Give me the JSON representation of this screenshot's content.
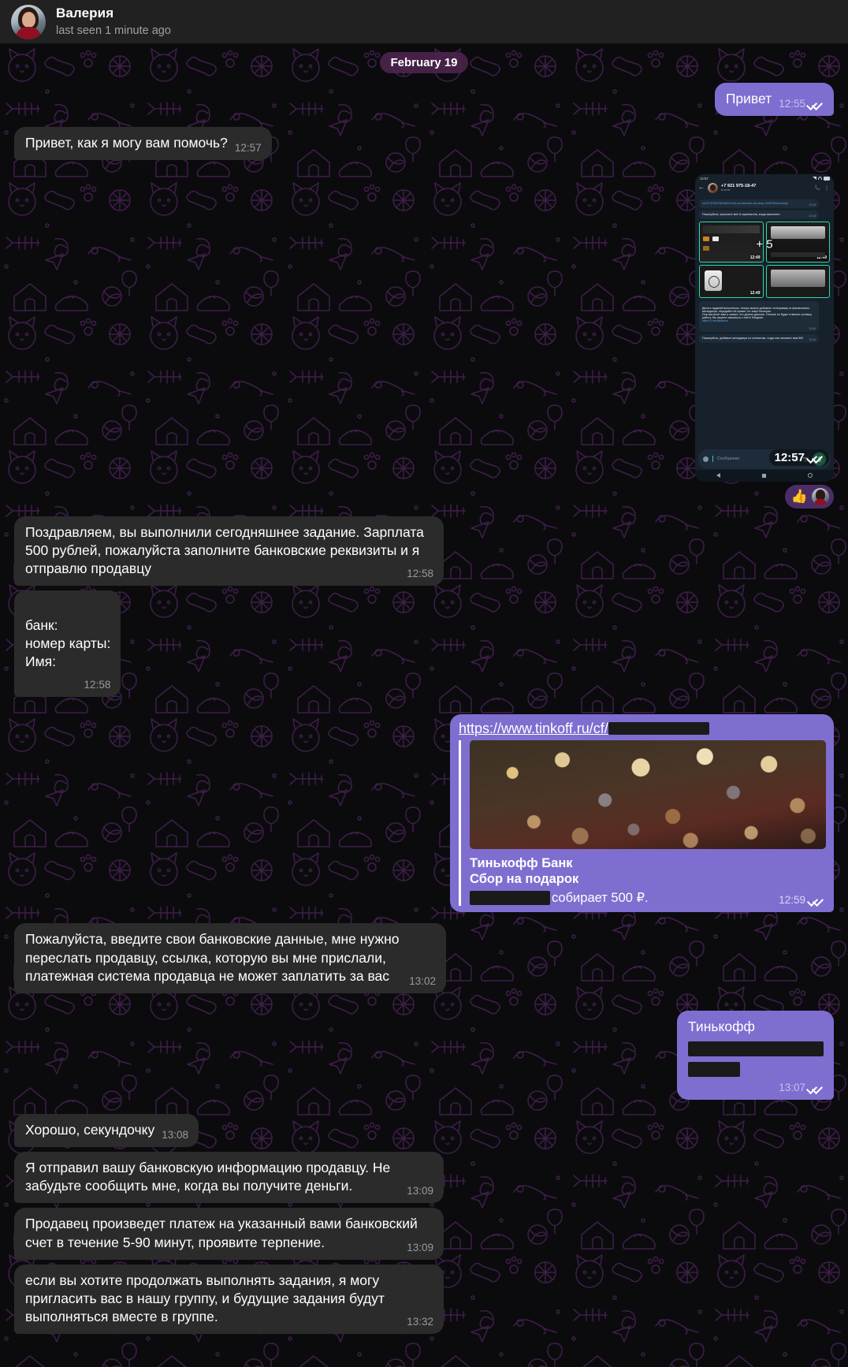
{
  "header": {
    "name": "Валерия",
    "status": "last seen 1 minute ago",
    "avatar_icon": "user-avatar"
  },
  "date_divider": "February 19",
  "messages": [
    {
      "id": "m1",
      "dir": "out",
      "text": "Привет",
      "time": "12:55",
      "read": true
    },
    {
      "id": "m2",
      "dir": "in",
      "text": "Привет, как я могу вам помочь?",
      "time": "12:57"
    },
    {
      "id": "m3",
      "dir": "out",
      "type": "photo",
      "time": "12:57",
      "read": true,
      "reaction": {
        "emoji": "👍",
        "avatar_icon": "reactor-avatar"
      }
    },
    {
      "id": "m4",
      "dir": "in",
      "text": "Поздравляем, вы выполнили сегодняшнее задание. Зарплата 500 рублей, пожалуйста заполните банковские реквизиты и я отправлю продавцу",
      "time": "12:58"
    },
    {
      "id": "m5",
      "dir": "in",
      "text": "банк:\nномер карты:\nИмя:",
      "time": "12:58"
    },
    {
      "id": "m6",
      "dir": "out",
      "type": "link_preview",
      "time": "12:59",
      "read": true,
      "url_visible": "https://www.tinkoff.ru/cf/",
      "url_redacted": true,
      "preview": {
        "image_alt": "bokeh-lights-photo",
        "title": "Тинькофф Банк",
        "subtitle": "Сбор на подарок",
        "description_redacted": true,
        "description": "собирает 500 ₽."
      }
    },
    {
      "id": "m7",
      "dir": "in",
      "text": "Пожалуйста, введите свои банковские данные, мне нужно переслать продавцу, ссылка, которую вы мне прислали, платежная система продавца не может заплатить за вас",
      "time": "13:02"
    },
    {
      "id": "m8",
      "dir": "out",
      "text": "Тинькофф",
      "time": "13:07",
      "read": true,
      "redacted_lines": 2
    },
    {
      "id": "m9",
      "dir": "in",
      "text": "Хорошо, секундочку",
      "time": "13:08"
    },
    {
      "id": "m10",
      "dir": "in",
      "text": "Я отправил вашу банковскую информацию продавцу. Не забудьте сообщить мне, когда вы получите деньги.",
      "time": "13:09"
    },
    {
      "id": "m11",
      "dir": "in",
      "text": "Продавец произведет платеж на указанный вами банковский счет в течение 5-90 минут, проявите терпение.",
      "time": "13:09"
    },
    {
      "id": "m12",
      "dir": "in",
      "text": "если вы хотите продолжать выполнять задания, я могу пригласить вас в нашу группу, и будущие задания будут выполняться вместе в группе.",
      "time": "13:32"
    }
  ],
  "embedded_screenshot": {
    "status_time": "12:57",
    "contact_phone": "+7 921 975-18-47",
    "contact_status": "в сети",
    "back_icon": "back-arrow-icon",
    "call_icon": "add-call-icon",
    "menu_icon": "overflow-menu-icon",
    "msg_link": "/ce717676673b1b80/24-60-sm-televizor-led-dexp-h24f7000cw-belyj/",
    "msg_link_time": "12:43",
    "msg_request": "Пожалуйста, пришлите мне 8 скриншотов, когда закончите",
    "msg_request_time": "12:43",
    "thumb_times": [
      "12:49",
      "12:49",
      "12:49"
    ],
    "more_count": "+ 5",
    "msg_long": "Десять заданий выполнены, теперь можно добавить телеграмму от финансового менеджера, передайте ей привет, ее зовут Валерия.\n  Она заплатит вам и скажет, что делать дальше. Отныне он будет отвечать за вашу работу. Вы можете связаться с ней в Telegram:",
    "msg_long_link": "https://t.me/zjlikkeoa",
    "msg_long_time": "12:54",
    "msg_last": "Пожалуйста, добавьте менеджера по контактам, тогда она заплатит вам 500",
    "msg_last_time": "12:54",
    "input_placeholder": "Сообщение",
    "emoji_icon": "emoji-icon",
    "attach_icon": "paperclip-icon",
    "camera_icon": "camera-icon",
    "mic_icon": "microphone-icon",
    "nav_back_icon": "nav-back-icon",
    "nav_home_icon": "nav-home-icon",
    "nav_recent_icon": "nav-recent-icon"
  },
  "colors": {
    "outgoing_bubble": "#7e6ed0",
    "incoming_bubble": "#2b2b2b",
    "header_bg": "#212121",
    "chat_bg": "#0b0b0e",
    "date_chip": "#502652",
    "reaction_pill": "#4b2d66",
    "link_text": "#ffffff",
    "embedded_accent": "#2fd8a8"
  }
}
